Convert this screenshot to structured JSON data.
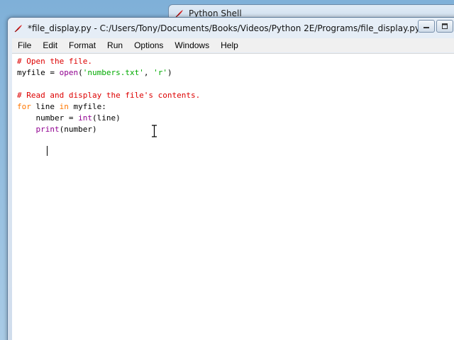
{
  "shell_window": {
    "title": "Python Shell"
  },
  "editor": {
    "title": "*file_display.py - C:/Users/Tony/Documents/Books/Videos/Python 2E/Programs/file_display.py*",
    "menu": [
      "File",
      "Edit",
      "Format",
      "Run",
      "Options",
      "Windows",
      "Help"
    ],
    "code_lines": [
      [
        {
          "t": "# Open the file.",
          "k": "comment"
        }
      ],
      [
        {
          "t": "myfile = ",
          "k": "plain"
        },
        {
          "t": "open",
          "k": "builtin"
        },
        {
          "t": "(",
          "k": "plain"
        },
        {
          "t": "'numbers.txt'",
          "k": "string"
        },
        {
          "t": ", ",
          "k": "plain"
        },
        {
          "t": "'r'",
          "k": "string"
        },
        {
          "t": ")",
          "k": "plain"
        }
      ],
      [],
      [
        {
          "t": "# Read and display the file's contents.",
          "k": "comment"
        }
      ],
      [
        {
          "t": "for",
          "k": "keyword"
        },
        {
          "t": " line ",
          "k": "plain"
        },
        {
          "t": "in",
          "k": "keyword"
        },
        {
          "t": " myfile:",
          "k": "plain"
        }
      ],
      [
        {
          "t": "    number = ",
          "k": "plain"
        },
        {
          "t": "int",
          "k": "builtin"
        },
        {
          "t": "(line)",
          "k": "plain"
        }
      ],
      [
        {
          "t": "    ",
          "k": "plain"
        },
        {
          "t": "print",
          "k": "builtin"
        },
        {
          "t": "(number)",
          "k": "plain"
        }
      ]
    ]
  },
  "icons": {
    "app": "tk-feather-icon",
    "minimize": "minimize-icon",
    "maximize": "maximize-icon"
  },
  "colors": {
    "comment": "#dd0000",
    "keyword": "#ff7700",
    "builtin": "#900090",
    "string": "#00aa00"
  }
}
